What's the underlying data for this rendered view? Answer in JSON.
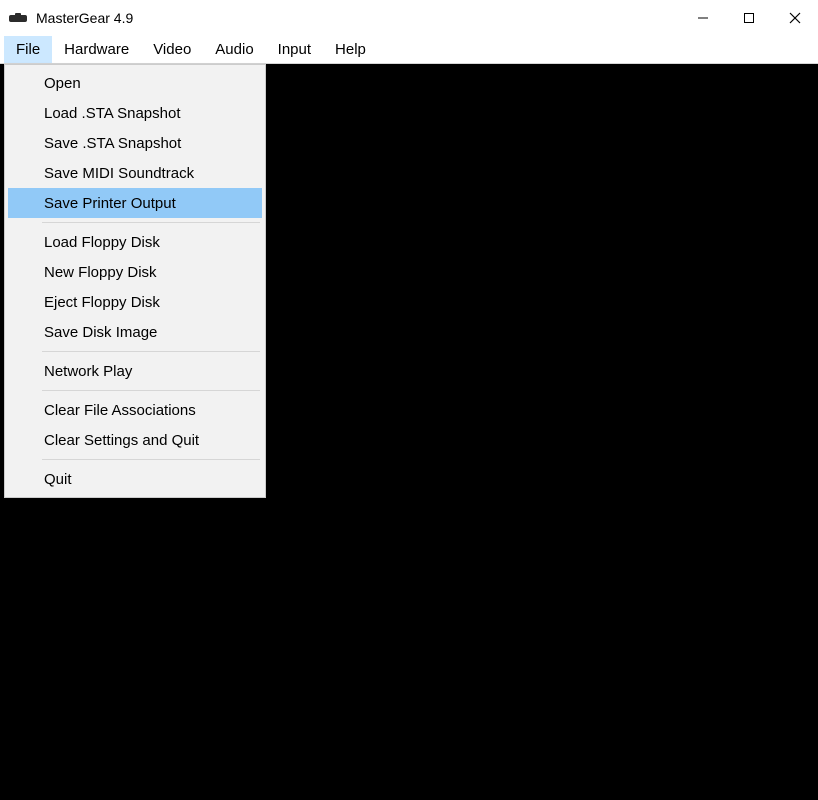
{
  "window": {
    "title": "MasterGear 4.9"
  },
  "menubar": {
    "file": "File",
    "hardware": "Hardware",
    "video": "Video",
    "audio": "Audio",
    "input": "Input",
    "help": "Help",
    "active": "file"
  },
  "file_menu": {
    "open": "Open",
    "load_sta": "Load .STA Snapshot",
    "save_sta": "Save .STA Snapshot",
    "save_midi": "Save MIDI Soundtrack",
    "save_printer": "Save Printer Output",
    "load_floppy": "Load Floppy Disk",
    "new_floppy": "New Floppy Disk",
    "eject_floppy": "Eject Floppy Disk",
    "save_disk_image": "Save Disk Image",
    "network_play": "Network Play",
    "clear_assoc": "Clear File Associations",
    "clear_quit": "Clear Settings and Quit",
    "quit": "Quit",
    "highlighted": "save_printer"
  }
}
